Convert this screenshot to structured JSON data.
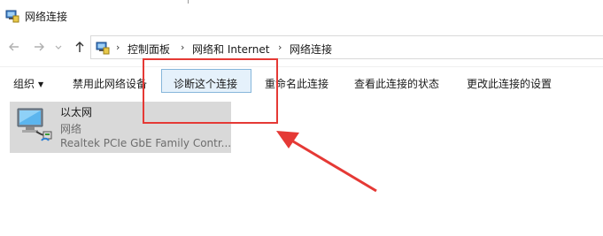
{
  "window": {
    "title": "网络连接"
  },
  "address": {
    "crumbs": [
      "控制面板",
      "网络和 Internet",
      "网络连接"
    ]
  },
  "commands": {
    "organize": "组织",
    "disable": "禁用此网络设备",
    "diagnose": "诊断这个连接",
    "rename": "重命名此连接",
    "view_status": "查看此连接的状态",
    "change_settings": "更改此连接的设置"
  },
  "connection": {
    "name": "以太网",
    "status": "网络",
    "adapter": "Realtek PCIe GbE Family Contr..."
  },
  "annotation": {
    "color": "#e53935"
  },
  "icons": {
    "back": "arrow-left-icon",
    "forward": "arrow-right-icon",
    "recent": "chevron-down-icon",
    "up": "arrow-up-icon",
    "network": "network-computer-icon"
  }
}
